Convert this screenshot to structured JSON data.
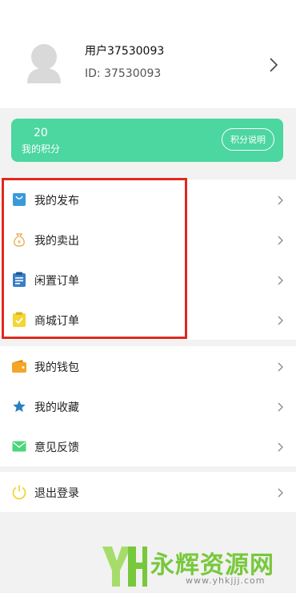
{
  "profile": {
    "username": "用户37530093",
    "user_id": "ID: 37530093"
  },
  "points": {
    "value": "20",
    "label": "我的积分",
    "explain_button": "积分说明"
  },
  "menu_group_1": [
    {
      "label": "我的发布",
      "icon": "shopping-bag-icon",
      "color": "#3a9ad9"
    },
    {
      "label": "我的卖出",
      "icon": "money-bag-icon",
      "color": "#e8a640"
    },
    {
      "label": "闲置订单",
      "icon": "clipboard-icon",
      "color": "#3a7fc6"
    },
    {
      "label": "商城订单",
      "icon": "check-clipboard-icon",
      "color": "#f4d535"
    }
  ],
  "menu_group_2": [
    {
      "label": "我的钱包",
      "icon": "wallet-icon",
      "color": "#f4a52a"
    },
    {
      "label": "我的收藏",
      "icon": "star-icon",
      "color": "#2a7fc0"
    },
    {
      "label": "意见反馈",
      "icon": "mail-icon",
      "color": "#4cd67a"
    }
  ],
  "menu_group_3": [
    {
      "label": "退出登录",
      "icon": "power-icon",
      "color": "#f4d535"
    }
  ],
  "watermark": {
    "name": "永辉资源网",
    "url": "www.yhkjjj.com"
  }
}
